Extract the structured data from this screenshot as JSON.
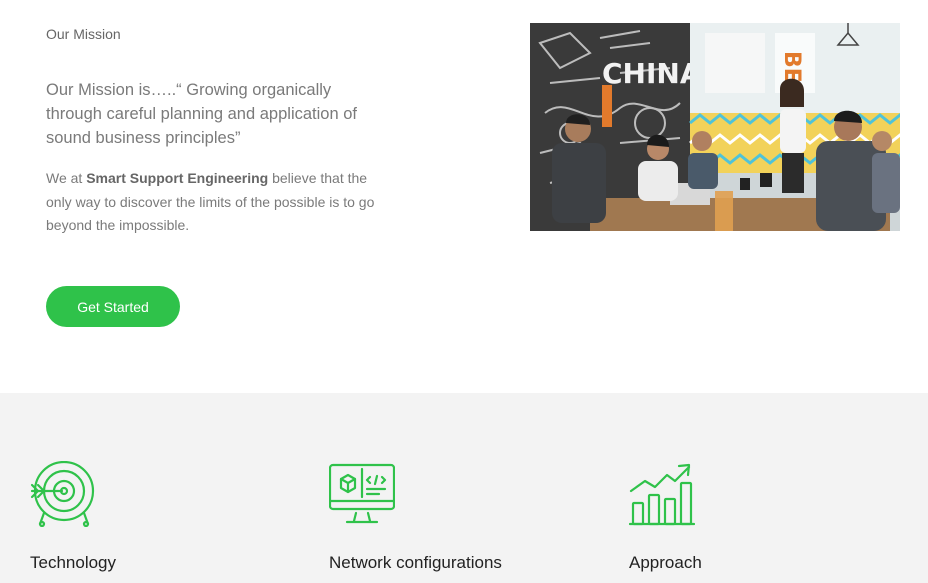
{
  "mission": {
    "eyebrow": "Our Mission",
    "quote": "Our Mission is…..“ Growing organically through careful planning and application of sound business principles”",
    "body_prefix": "We at ",
    "body_company": "Smart Support Engineering",
    "body_suffix": " believe that the only way to discover the limits of the possible is to go beyond the impossible.",
    "cta_label": "Get Started"
  },
  "photo": {
    "wall_letters": "BE",
    "wall_text": "CHINA"
  },
  "features": [
    {
      "title": "Technology",
      "icon": "target-arrow-icon"
    },
    {
      "title": "Network configurations",
      "icon": "monitor-code-icon"
    },
    {
      "title": "Approach",
      "icon": "growth-chart-icon"
    }
  ],
  "colors": {
    "accent": "#2fc24a",
    "band": "#f3f3f3",
    "text": "#7a7a7a"
  }
}
